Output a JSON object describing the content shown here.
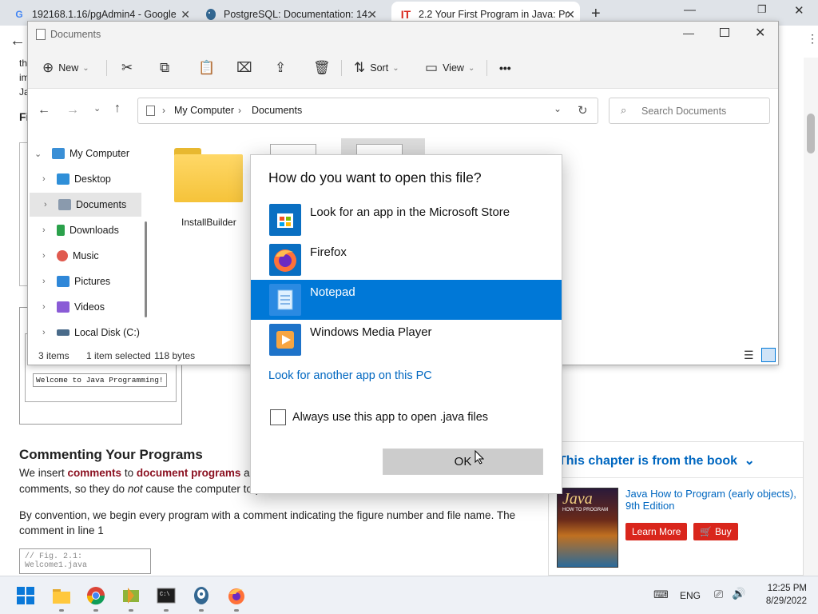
{
  "browser": {
    "tabs": [
      {
        "title": "192168.1.16/pgAdmin4 - Google",
        "icon": "google-icon"
      },
      {
        "title": "PostgreSQL: Documentation: 14:",
        "icon": "postgresql-icon"
      },
      {
        "title": "2.2 Your First Program in Java: Pr",
        "icon": "informit-icon"
      }
    ],
    "new_tab": "+"
  },
  "page": {
    "fragments": [
      "th",
      "im",
      "Ja",
      "Fi"
    ],
    "code_welcome": "Welcome to Java Programming!",
    "heading": "Commenting Your Programs",
    "para1_a": "We insert ",
    "para1_b": "comments",
    "para1_c": " to ",
    "para1_d": "document programs",
    "para1_e": " and",
    "para1_line2_a": "comments, so they do ",
    "para1_not": "not",
    "para1_line2_b": " cause the computer to p",
    "para2": "By convention, we begin every program with a comment indicating the figure number and file name. The comment in line 1",
    "code_comment": "// Fig. 2.1: Welcome1.java"
  },
  "book_panel": {
    "header": "This chapter is from the book",
    "book_title": "Java How to Program (early objects), 9th Edition",
    "learn_more": "Learn More",
    "buy": "Buy",
    "cover_title": "Java",
    "cover_sub": "HOW TO PROGRAM"
  },
  "explorer": {
    "title": "Documents",
    "toolbar": {
      "new": "New",
      "sort": "Sort",
      "view": "View",
      "more": "•••"
    },
    "breadcrumb": [
      "My Computer",
      "Documents"
    ],
    "search_placeholder": "Search Documents",
    "tree": [
      {
        "label": "My Computer",
        "icon": "computer-icon",
        "color": "#3a8fd6"
      },
      {
        "label": "Desktop",
        "icon": "desktop-icon",
        "color": "#2f8fd8"
      },
      {
        "label": "Documents",
        "icon": "documents-icon",
        "color": "#8a9aad"
      },
      {
        "label": "Downloads",
        "icon": "downloads-icon",
        "color": "#2ba14b"
      },
      {
        "label": "Music",
        "icon": "music-icon",
        "color": "#e05a4f"
      },
      {
        "label": "Pictures",
        "icon": "pictures-icon",
        "color": "#2f87d8"
      },
      {
        "label": "Videos",
        "icon": "videos-icon",
        "color": "#8a5bd6"
      },
      {
        "label": "Local Disk (C:)",
        "icon": "disk-icon",
        "color": "#4a6b8a"
      }
    ],
    "folder_label": "InstallBuilder",
    "status": {
      "items": "3 items",
      "selected": "1 item selected",
      "size": "118 bytes"
    }
  },
  "dialog": {
    "question": "How do you want to open this file?",
    "apps": [
      {
        "name": "Look for an app in the Microsoft Store",
        "icon": "microsoft-store-icon",
        "selected": false
      },
      {
        "name": "Firefox",
        "icon": "firefox-icon",
        "selected": false
      },
      {
        "name": "Notepad",
        "icon": "notepad-icon",
        "selected": true
      },
      {
        "name": "Windows Media Player",
        "icon": "windows-media-player-icon",
        "selected": false
      }
    ],
    "another_app": "Look for another app on this PC",
    "always_use": "Always use this app to open .java files",
    "ok": "OK"
  },
  "taskbar": {
    "apps": [
      "start-icon",
      "file-explorer-icon",
      "chrome-icon",
      "installbuilder-icon",
      "terminal-icon",
      "pgadmin-icon",
      "firefox-icon"
    ],
    "lang": "ENG",
    "time": "12:25 PM",
    "date": "8/29/2022"
  },
  "colors": {
    "accent": "#0078d7",
    "link": "#0067c0",
    "redbtn": "#d9261c"
  }
}
